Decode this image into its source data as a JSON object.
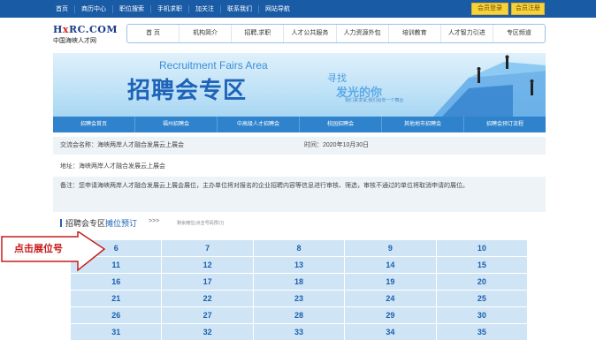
{
  "topbar": {
    "links": [
      "首页",
      "商历中心",
      "职位搜索",
      "手机求职",
      "加关注",
      "联系我们",
      "网站导航"
    ],
    "login": "会员登录",
    "register": "会员注册"
  },
  "logo": {
    "main_prefix": "H",
    "main_x": "x",
    "main_rest": "RC.COM",
    "sub": "中国海峡人才网"
  },
  "mainnav": [
    "首 页",
    "机构简介",
    "招聘,求职",
    "人才公共服务",
    "人力资源外包",
    "培训教育",
    "人才智力引进",
    "专区频道"
  ],
  "banner": {
    "en": "Recruitment Fairs Area",
    "cn": "招聘会专区",
    "find": "寻找",
    "shine": "发光的你",
    "tag": "我们来求贤,我们给你一个舞台"
  },
  "subnav": [
    "招聘会首页",
    "福州招聘会",
    "中高级人才招聘会",
    "校园招聘会",
    "其他地市招聘会",
    "招聘会预订流程"
  ],
  "info": {
    "name": "交流会名称：海峡两岸人才融合发展云上展会",
    "time": "时间：2020年10月30日",
    "address": "地址：海峡两岸人才融合发展云上展会",
    "note": "备注：您申请海峡两岸人才融合发展云上展会展位，主办单位将对报名的企业招聘内容等信息进行审核、筛选，审核不通过的单位将取消申请的展位。"
  },
  "section": {
    "title": "招聘会专区",
    "highlight": "摊位预订",
    "arrows": ">>>",
    "note": "剩余摊位(点击号码预订)"
  },
  "booths": [
    [
      "6",
      "7",
      "8",
      "9",
      "10"
    ],
    [
      "11",
      "12",
      "13",
      "14",
      "15"
    ],
    [
      "16",
      "17",
      "18",
      "19",
      "20"
    ],
    [
      "21",
      "22",
      "23",
      "24",
      "25"
    ],
    [
      "26",
      "27",
      "28",
      "29",
      "30"
    ],
    [
      "31",
      "32",
      "33",
      "34",
      "35"
    ]
  ],
  "callout": {
    "label": "点击展位号"
  },
  "colors": {
    "brand_blue": "#1a5ba5",
    "accent_yellow": "#f6d23b",
    "booth_bg": "#cfe5f6",
    "callout_red": "#c81c1c"
  }
}
